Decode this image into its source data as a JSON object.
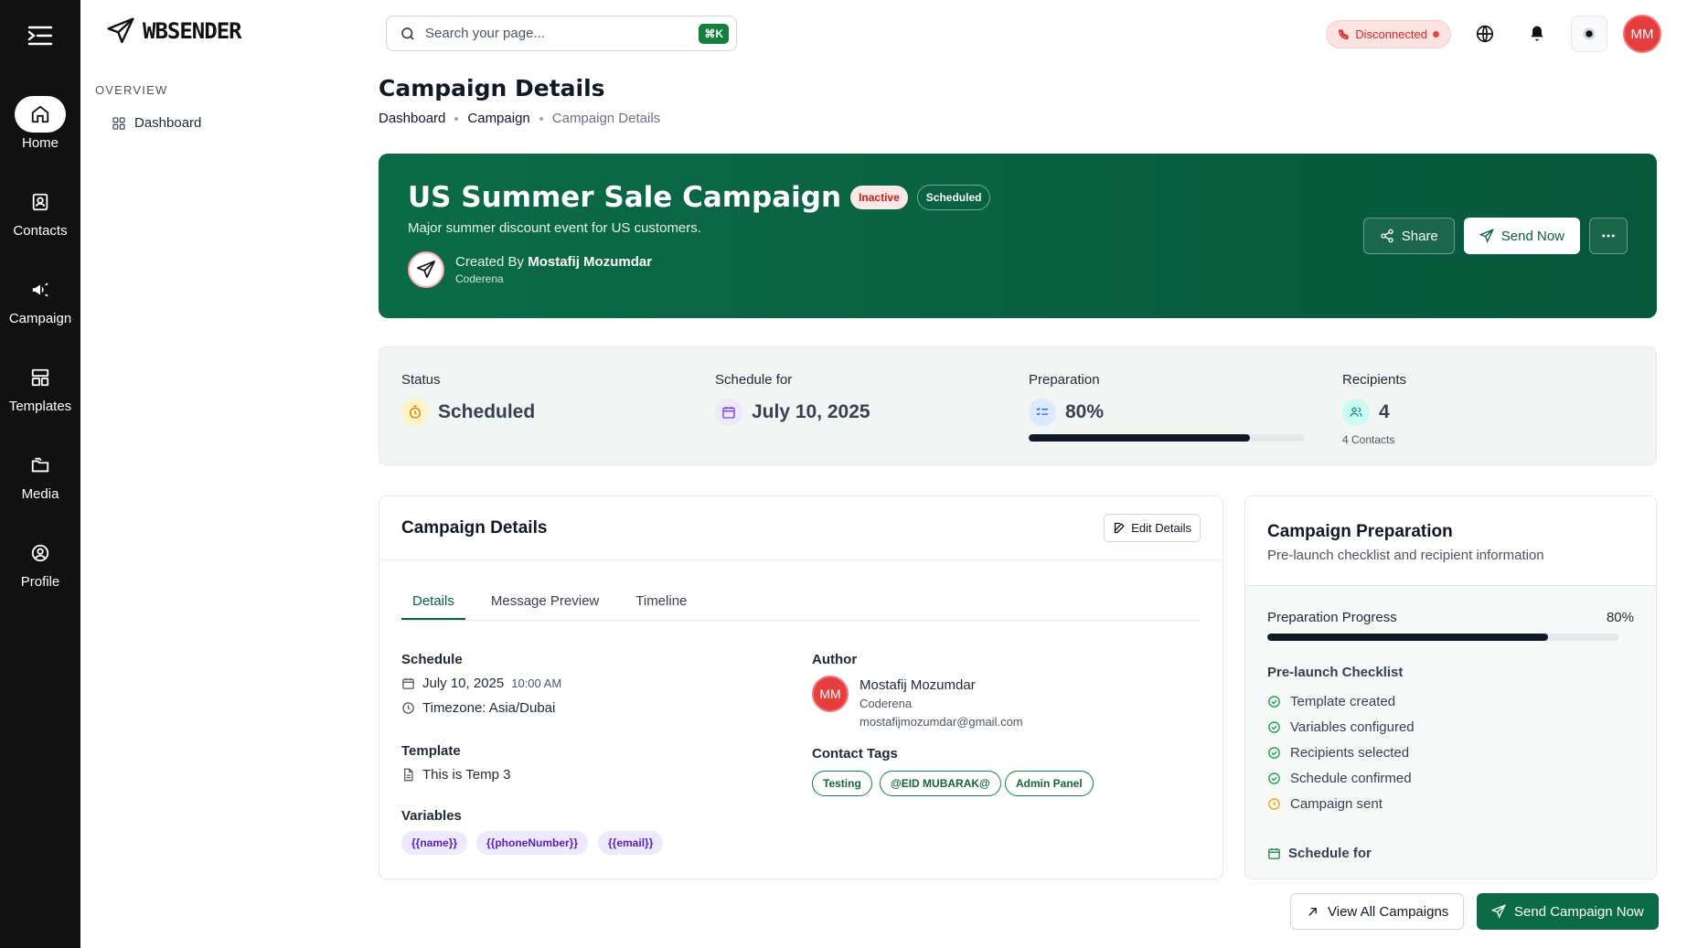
{
  "app": {
    "name": "WBSENDER"
  },
  "rail": [
    {
      "label": "Home",
      "icon": "home-icon"
    },
    {
      "label": "Contacts",
      "icon": "contacts-icon"
    },
    {
      "label": "Campaign",
      "icon": "megaphone-icon"
    },
    {
      "label": "Templates",
      "icon": "templates-icon"
    },
    {
      "label": "Media",
      "icon": "folder-icon"
    },
    {
      "label": "Profile",
      "icon": "profile-icon"
    }
  ],
  "sidebar": {
    "section": "OVERVIEW",
    "items": [
      {
        "label": "Dashboard",
        "icon": "grid-icon"
      }
    ]
  },
  "search": {
    "placeholder": "Search your page...",
    "shortcut": "⌘K"
  },
  "header": {
    "status": "Disconnected",
    "avatar": "MM"
  },
  "page": {
    "title": "Campaign Details",
    "breadcrumb": [
      "Dashboard",
      "Campaign",
      "Campaign Details"
    ]
  },
  "hero": {
    "title": "US Summer Sale Campaign",
    "badge_status": "Inactive",
    "badge_state": "Scheduled",
    "description": "Major summer discount event for US customers.",
    "created_by_label": "Created By",
    "creator": "Mostafij Mozumdar",
    "org": "Coderena",
    "share": "Share",
    "send_now": "Send Now"
  },
  "stats": {
    "status": {
      "label": "Status",
      "value": "Scheduled"
    },
    "schedule": {
      "label": "Schedule for",
      "value": "July 10, 2025"
    },
    "preparation": {
      "label": "Preparation",
      "value": "80%",
      "progress": 0.8
    },
    "recipients": {
      "label": "Recipients",
      "value": "4",
      "sub": "4 Contacts"
    }
  },
  "details": {
    "title": "Campaign Details",
    "edit": "Edit Details",
    "tabs": [
      "Details",
      "Message Preview",
      "Timeline"
    ],
    "schedule_label": "Schedule",
    "date": "July 10, 2025",
    "time": "10:00 AM",
    "timezone": "Timezone: Asia/Dubai",
    "template_label": "Template",
    "template": "This is Temp 3",
    "variables_label": "Variables",
    "variables": [
      "{{name}}",
      "{{phoneNumber}}",
      "{{email}}"
    ],
    "author_label": "Author",
    "author": {
      "initials": "MM",
      "name": "Mostafij Mozumdar",
      "org": "Coderena",
      "email": "mostafijmozumdar@gmail.com"
    },
    "tags_label": "Contact Tags",
    "tags": [
      "Testing",
      "@EID MUBARAK@",
      "Admin Panel"
    ]
  },
  "preparation": {
    "title": "Campaign Preparation",
    "subtitle": "Pre-launch checklist and recipient information",
    "progress_label": "Preparation Progress",
    "progress_value": "80%",
    "progress": 0.8,
    "checklist_label": "Pre-launch Checklist",
    "checklist": [
      {
        "label": "Template created",
        "done": true
      },
      {
        "label": "Variables configured",
        "done": true
      },
      {
        "label": "Recipients selected",
        "done": true
      },
      {
        "label": "Schedule confirmed",
        "done": true
      },
      {
        "label": "Campaign sent",
        "done": false
      }
    ],
    "schedule_label": "Schedule for"
  },
  "footer": {
    "view_all": "View All Campaigns",
    "send": "Send Campaign Now"
  },
  "colors": {
    "brand": "#0b6b47",
    "rail": "#111111",
    "danger": "#e53e3e",
    "pending": "#f59e0b"
  }
}
